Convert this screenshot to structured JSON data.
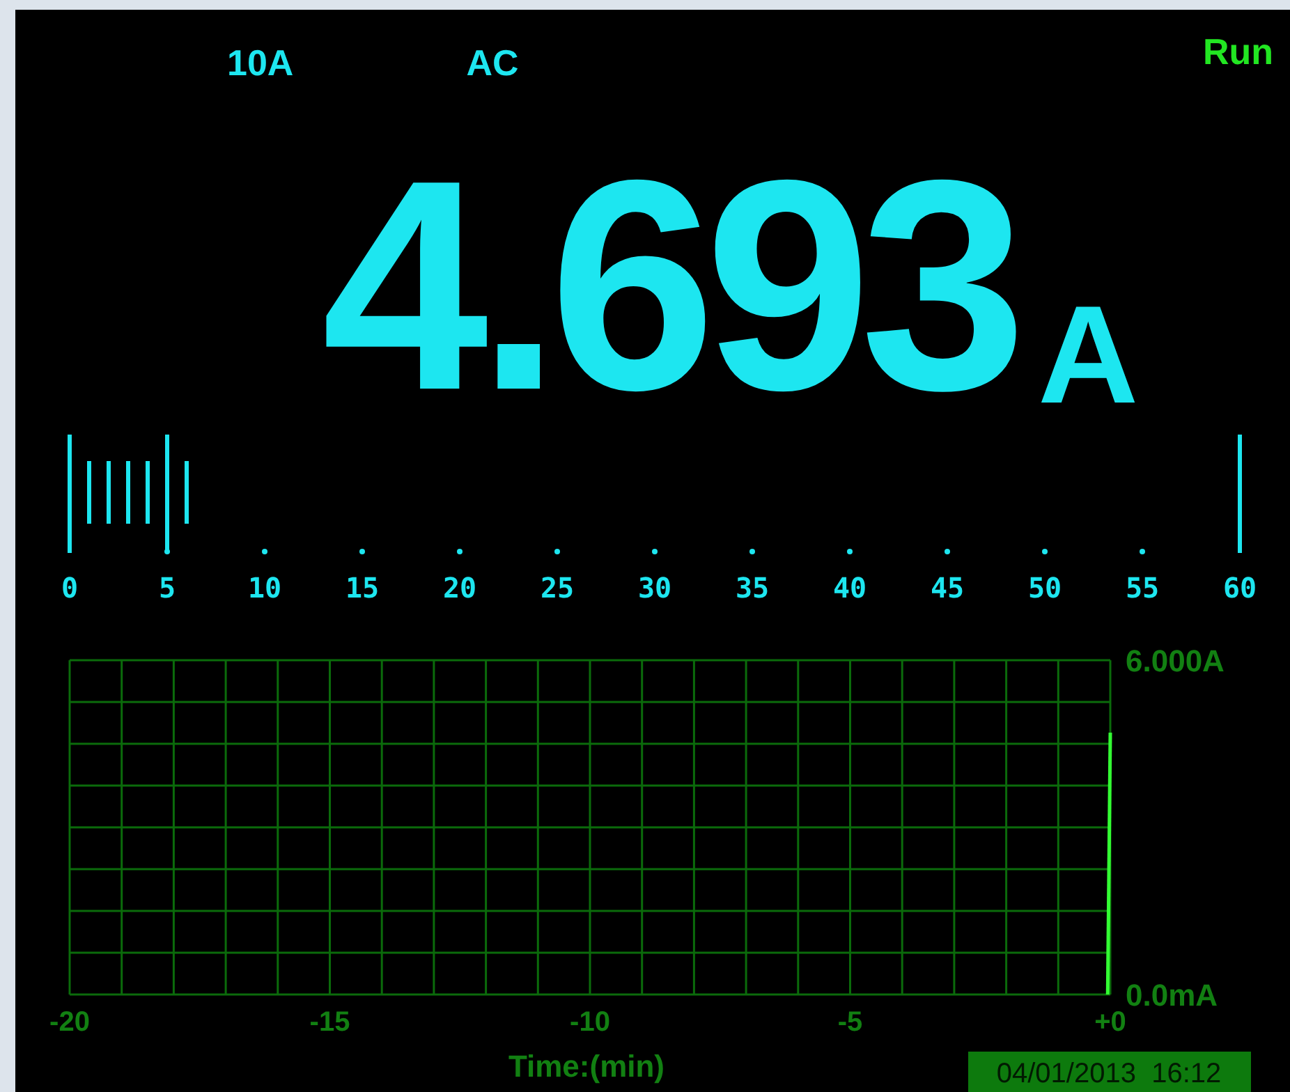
{
  "header": {
    "range": "10A",
    "coupling": "AC",
    "status": "Run"
  },
  "reading": {
    "value": "4.693",
    "unit": "A"
  },
  "bargraph": {
    "level": 0.1,
    "scale_labels": [
      "0",
      "5",
      "10",
      "15",
      "20",
      "25",
      "30",
      "35",
      "40",
      "45",
      "50",
      "55",
      "60"
    ]
  },
  "trend": {
    "chart_data": {
      "type": "line",
      "xlabel": "Time:(min)",
      "x": [
        -0.05,
        0
      ],
      "series": [
        {
          "color": "#33ff33",
          "values": [
            0,
            4.7
          ]
        }
      ],
      "grid": true,
      "xlim": [
        -20,
        0
      ],
      "ylim": [
        0,
        6
      ],
      "xticks": [
        -20,
        -15,
        -10,
        -5,
        {
          "value": 0,
          "label": "+0"
        }
      ],
      "yticks": [
        {
          "value": 0,
          "label": "0.0mA"
        },
        {
          "value": 6,
          "label": "6.000A"
        }
      ]
    },
    "timestamp": "04/01/2013  16:12"
  }
}
